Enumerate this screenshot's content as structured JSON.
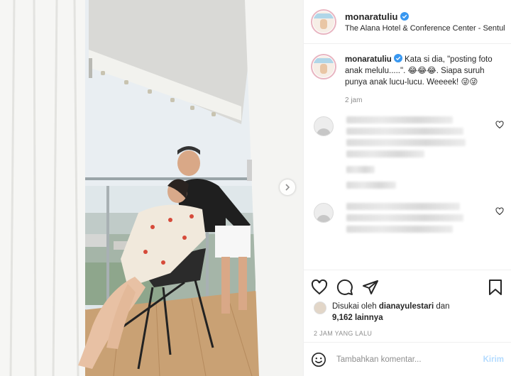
{
  "post": {
    "username": "monaratuliu",
    "location": "The Alana Hotel & Conference Center - Sentul",
    "avatar_icon": "profile-avatar",
    "verified_icon": "verified-badge-icon",
    "photo_description_icon": "photo-balcony-couple",
    "carousel_next_icon": "chevron-right-icon"
  },
  "caption": {
    "username": "monaratuliu",
    "text": " Kata si dia, \"posting foto anak melulu.....\". 😂😂😂. Siapa suruh punya anak lucu-lucu. Weeeek! 😜😜",
    "time": "2 jam"
  },
  "actions": {
    "like_icon": "heart-icon",
    "comment_icon": "comment-icon",
    "share_icon": "paper-plane-icon",
    "save_icon": "bookmark-icon"
  },
  "likes": {
    "prefix": "Disukai oleh ",
    "liker": "dianayulestari",
    "connector": " dan",
    "count": "9,162 lainnya"
  },
  "timestamp": "2 JAM YANG LALU",
  "comment_box": {
    "placeholder": "Tambahkan komentar...",
    "submit_label": "Kirim",
    "emoji_icon": "smiley-icon"
  },
  "colors": {
    "verified": "#3897f0",
    "post_disabled": "#b3dbff",
    "muted_text": "#8e8e8e",
    "border": "#efefef"
  }
}
